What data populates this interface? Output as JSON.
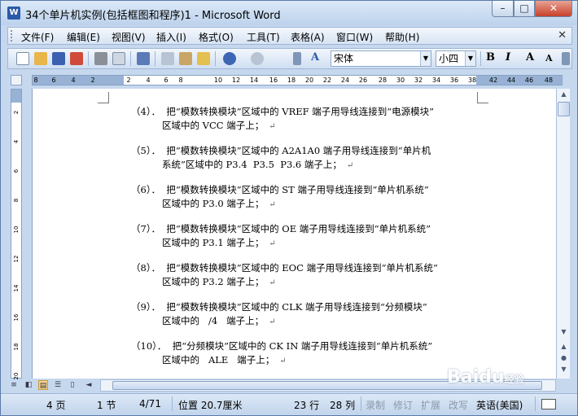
{
  "window": {
    "title": "34个单片机实例(包括框图和程序)1 - Microsoft Word",
    "app_icon_letter": "W",
    "controls": {
      "minimize": "–",
      "maximize": "□",
      "close": "✕"
    }
  },
  "menubar": {
    "items": [
      "文件(F)",
      "编辑(E)",
      "视图(V)",
      "插入(I)",
      "格式(O)",
      "工具(T)",
      "表格(A)",
      "窗口(W)",
      "帮助(H)"
    ],
    "close_glyph": "✕"
  },
  "toolbar": {
    "font_name": "宋体",
    "font_size": "小四",
    "bold": "B",
    "italic": "I",
    "grow": "A",
    "shrink": "A",
    "style_glyph": "A"
  },
  "ruler": {
    "labels": [
      "8",
      "6",
      "4",
      "2",
      "2",
      "4",
      "6",
      "8",
      "10",
      "12",
      "14",
      "16",
      "18",
      "20",
      "22",
      "24",
      "26",
      "28",
      "30",
      "32",
      "34",
      "36",
      "38",
      "42",
      "44",
      "46",
      "48"
    ]
  },
  "vruler": {
    "labels": [
      "2",
      "4",
      "6",
      "8",
      "10",
      "12",
      "14",
      "16",
      "18",
      "20"
    ]
  },
  "document": {
    "paragraphs": [
      {
        "l1": "（4）．  把“模数转换模块”区域中的 VREF 端子用导线连接到“电源模块”",
        "l2": "区域中的 VCC 端子上；"
      },
      {
        "l1": "（5）．  把“模数转换模块”区域中的 A2A1A0 端子用导线连接到“单片机",
        "l2": "系统”区域中的 P3.4  P3.5  P3.6 端子上；"
      },
      {
        "l1": "（6）．  把“模数转换模块”区域中的 ST 端子用导线连接到“单片机系统”",
        "l2": "区域中的 P3.0 端子上；"
      },
      {
        "l1": "（7）．  把“模数转换模块”区域中的 OE 端子用导线连接到“单片机系统”",
        "l2": "区域中的 P3.1 端子上；"
      },
      {
        "l1": "（8）．  把“模数转换模块”区域中的 EOC 端子用导线连接到“单片机系统”",
        "l2": "区域中的 P3.2 端子上；"
      },
      {
        "l1": "（9）．  把“模数转换模块”区域中的 CLK 端子用导线连接到“分频模块”",
        "l2": "区域中的   /4   端子上；"
      },
      {
        "l1": "（10）．  把“分频模块”区域中的 CK IN 端子用导线连接到“单片机系统”",
        "l2": "区域中的   ALE   端子上；"
      }
    ],
    "para_mark": "↵"
  },
  "statusbar": {
    "page": "4 页",
    "section": "1 节",
    "page_of": "4/71",
    "position": "位置 20.7厘米",
    "line": "23 行",
    "column": "28 列",
    "rec": "录制",
    "trk": "修订",
    "ext": "扩展",
    "ovr": "改写",
    "language": "英语(美国)"
  },
  "watermark": {
    "text": "Baidu",
    "sub": "经验"
  }
}
